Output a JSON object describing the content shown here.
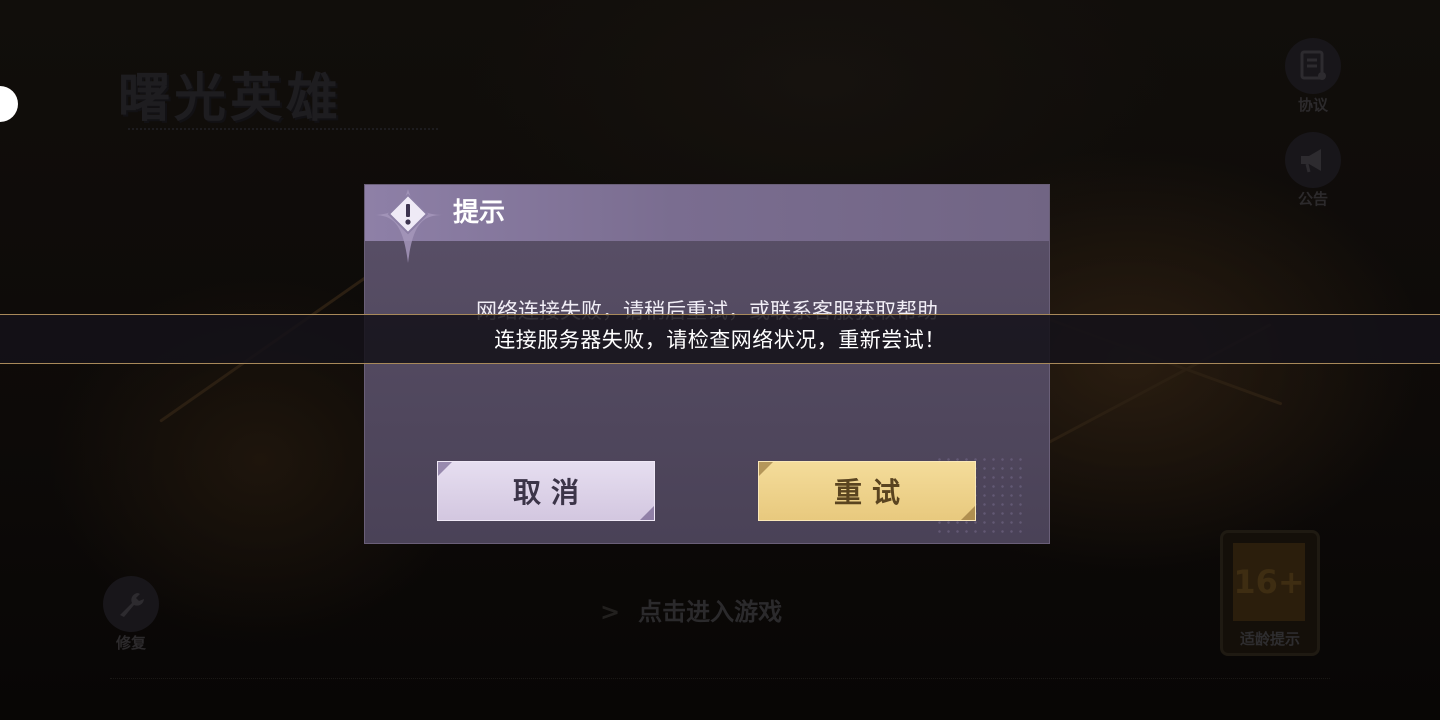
{
  "background": {
    "logo_text": "曙光英雄",
    "side_buttons": [
      {
        "label": "协议",
        "icon": "document-icon"
      },
      {
        "label": "公告",
        "icon": "megaphone-icon"
      }
    ],
    "repair_label": "修复",
    "enter_game_label": "点击进入游戏",
    "age_rating": {
      "badge": "16+",
      "label": "适龄提示"
    }
  },
  "dialog": {
    "title": "提示",
    "message": "网络连接失败，请稍后重试，或联系客服获取帮助",
    "cancel_label": "取消",
    "retry_label": "重试"
  },
  "toast": {
    "message": "连接服务器失败，请检查网络状况，重新尝试！"
  },
  "colors": {
    "dialog_bg": "#4f4660",
    "dialog_header": "#8e80a7",
    "cancel_button": "#ded4ea",
    "retry_button": "#eed28a",
    "toast_border": "#a8895a"
  }
}
